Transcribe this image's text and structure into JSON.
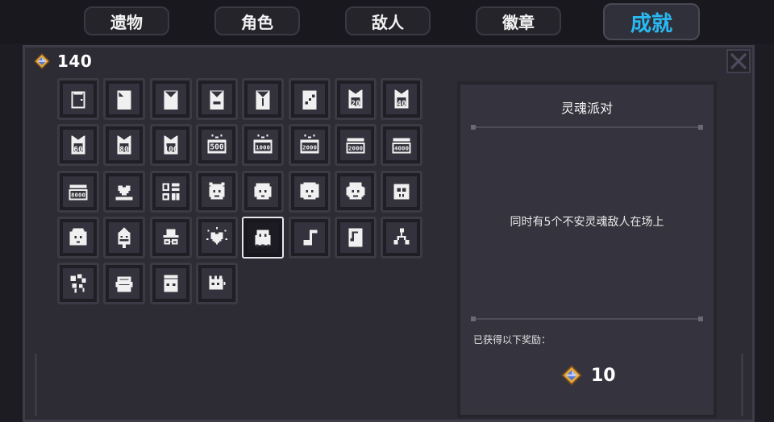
{
  "tabs": [
    {
      "label": "遗物",
      "active": false
    },
    {
      "label": "角色",
      "active": false
    },
    {
      "label": "敌人",
      "active": false
    },
    {
      "label": "徽章",
      "active": false
    },
    {
      "label": "成就",
      "active": true
    }
  ],
  "currency": {
    "total": "140",
    "icon": "gem-coin-icon"
  },
  "achievements": [
    {
      "icon": "door-achievement-icon",
      "text": ""
    },
    {
      "icon": "card-scroll-achievement-icon",
      "text": ""
    },
    {
      "icon": "envelope-achievement-icon",
      "text": ""
    },
    {
      "icon": "envelope-crown-achievement-icon",
      "text": ""
    },
    {
      "icon": "envelope-split-achievement-icon",
      "text": ""
    },
    {
      "icon": "envelope-dots-achievement-icon",
      "text": ""
    },
    {
      "icon": "banner-20-achievement-icon",
      "text": "20"
    },
    {
      "icon": "banner-40-achievement-icon",
      "text": "40"
    },
    {
      "icon": "banner-60-achievement-icon",
      "text": "60"
    },
    {
      "icon": "banner-80-achievement-icon",
      "text": "80"
    },
    {
      "icon": "banner-100-achievement-icon",
      "text": "100"
    },
    {
      "icon": "kills-500-achievement-icon",
      "text": "500"
    },
    {
      "icon": "kills-1000-achievement-icon",
      "text": "1000"
    },
    {
      "icon": "kills-2000-achievement-icon",
      "text": "2000"
    },
    {
      "icon": "brick-2000-achievement-icon",
      "text": "2000"
    },
    {
      "icon": "brick-4000-achievement-icon",
      "text": "4000"
    },
    {
      "icon": "brick-8000-achievement-icon",
      "text": "8000"
    },
    {
      "icon": "heart-stack-achievement-icon",
      "text": ""
    },
    {
      "icon": "grid-achievement-icon",
      "text": ""
    },
    {
      "icon": "cat-face-achievement-icon",
      "text": ""
    },
    {
      "icon": "girl-face-achievement-icon",
      "text": ""
    },
    {
      "icon": "twin-tail-face-achievement-icon",
      "text": ""
    },
    {
      "icon": "headphones-face-achievement-icon",
      "text": ""
    },
    {
      "icon": "skull-box-achievement-icon",
      "text": ""
    },
    {
      "icon": "long-hair-face-achievement-icon",
      "text": ""
    },
    {
      "icon": "turnip-achievement-icon",
      "text": ""
    },
    {
      "icon": "hat-glasses-achievement-icon",
      "text": ""
    },
    {
      "icon": "sparkle-heart-achievement-icon",
      "text": ""
    },
    {
      "icon": "ghost-achievement-icon",
      "text": "",
      "selected": true
    },
    {
      "icon": "music-note-achievement-icon",
      "text": ""
    },
    {
      "icon": "music-sheet-achievement-icon",
      "text": ""
    },
    {
      "icon": "molecule-achievement-icon",
      "text": ""
    },
    {
      "icon": "balloons-achievement-icon",
      "text": ""
    },
    {
      "icon": "coin-stack-achievement-icon",
      "text": ""
    },
    {
      "icon": "jar-achievement-icon",
      "text": ""
    },
    {
      "icon": "castle-achievement-icon",
      "text": ""
    }
  ],
  "detail": {
    "title": "灵魂派对",
    "description": "同时有5个不安灵魂敌人在场上",
    "reward_label": "已获得以下奖励：",
    "reward_value": "10",
    "reward_icon": "gem-coin-icon"
  },
  "colors": {
    "accent": "#29b9f2",
    "background": "#1d1c23",
    "panel": "#2d2c35",
    "tile_fill": "#34333d",
    "icon": "#f0f0f0"
  }
}
